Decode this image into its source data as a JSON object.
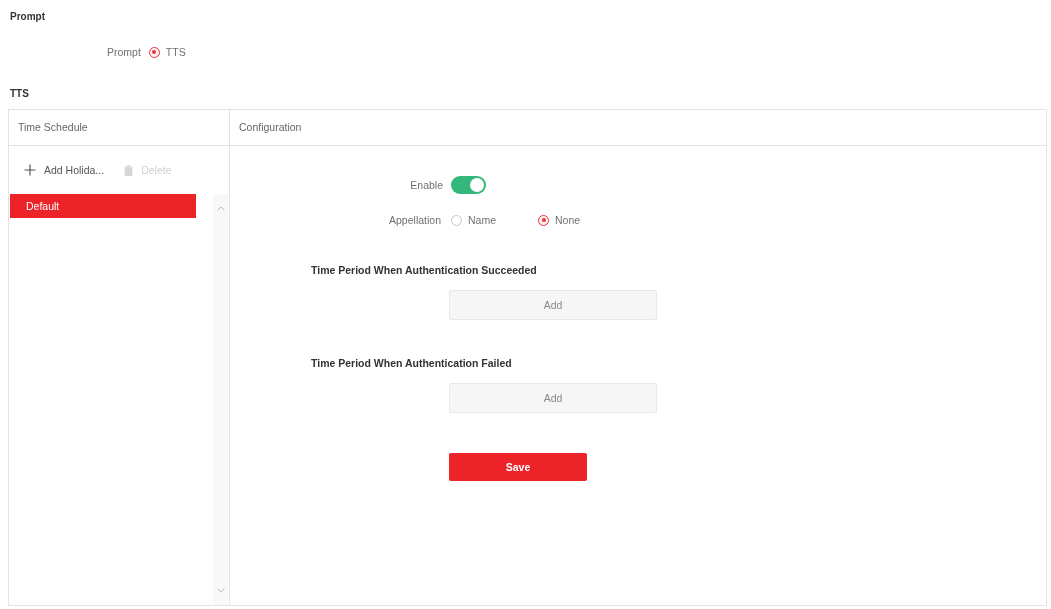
{
  "prompt_section": {
    "heading": "Prompt",
    "field_label": "Prompt",
    "options": [
      {
        "label": "TTS",
        "selected": true
      }
    ]
  },
  "tts_section": {
    "heading": "TTS",
    "time_schedule": {
      "header": "Time Schedule",
      "toolbar": [
        {
          "kind": "add",
          "label": "Add Holida...",
          "disabled": false
        },
        {
          "kind": "delete",
          "label": "Delete",
          "disabled": true
        }
      ],
      "items": [
        {
          "label": "Default",
          "selected": true
        }
      ]
    },
    "configuration": {
      "header": "Configuration",
      "enable": {
        "label": "Enable",
        "on": true
      },
      "appellation": {
        "label": "Appellation",
        "options": [
          {
            "label": "Name",
            "selected": false
          },
          {
            "label": "None",
            "selected": true
          }
        ]
      },
      "periods": [
        {
          "title": "Time Period When Authentication Succeeded",
          "button": "Add"
        },
        {
          "title": "Time Period When Authentication Failed",
          "button": "Add"
        }
      ],
      "save_button": "Save"
    }
  }
}
